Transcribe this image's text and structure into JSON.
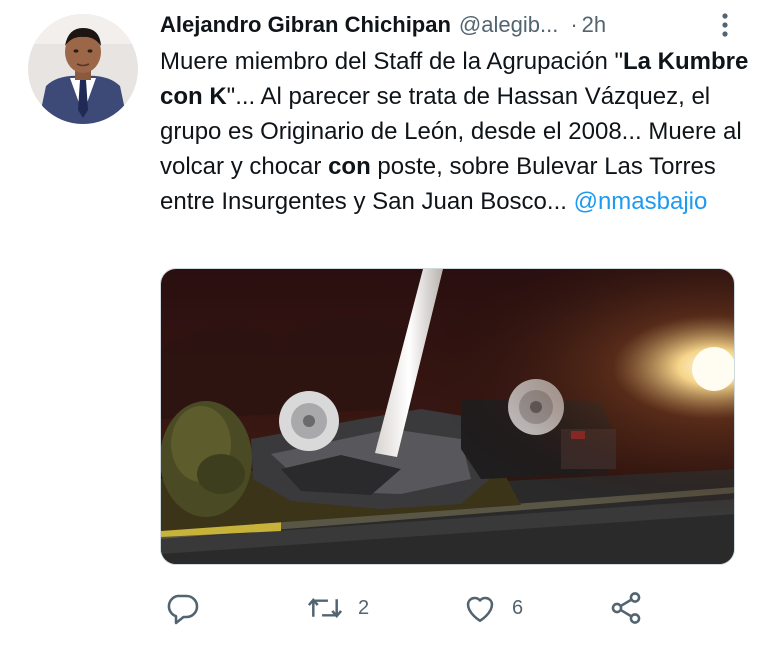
{
  "author": {
    "name": "Alejandro Gibran Chichipan",
    "handle": "@alegib...",
    "separator": "·",
    "time": "2h"
  },
  "tweet": {
    "segments": [
      {
        "text": "Muere miembro del Staff de la Agrupación \"",
        "style": "normal"
      },
      {
        "text": "La Kumbre con K",
        "style": "bold"
      },
      {
        "text": "\"... Al parecer se trata de Hassan Vázquez, el grupo es Originario de León, desde el 2008... Muere al volcar y chocar ",
        "style": "normal"
      },
      {
        "text": "con",
        "style": "bold"
      },
      {
        "text": " poste, sobre Bulevar Las Torres entre Insurgentes y San Juan Bosco... ",
        "style": "normal"
      },
      {
        "text": "@nmasbajio",
        "style": "mention"
      }
    ]
  },
  "media": {
    "description_icon": "photo-crashed-overturned-car-at-night"
  },
  "actions": {
    "reply": {
      "icon": "reply-icon",
      "count": ""
    },
    "retweet": {
      "icon": "retweet-icon",
      "count": "2"
    },
    "like": {
      "icon": "heart-icon",
      "count": "6"
    },
    "share": {
      "icon": "share-icon",
      "count": ""
    }
  },
  "colors": {
    "text": "#0f1419",
    "secondary": "#536471",
    "link": "#1d9bf0"
  }
}
